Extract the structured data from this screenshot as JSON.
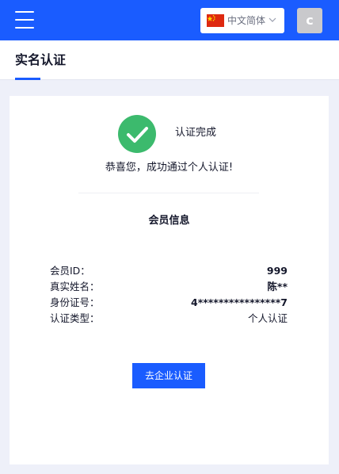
{
  "header": {
    "language": "中文简体",
    "avatar_initial": "c"
  },
  "tabbar": {
    "title": "实名认证"
  },
  "status": {
    "title": "认证完成",
    "message": "恭喜您，成功通过个人认证!"
  },
  "member_info": {
    "title": "会员信息",
    "rows": [
      {
        "label": "会员ID：",
        "value": "999"
      },
      {
        "label": "真实姓名：",
        "value": "陈**"
      },
      {
        "label": "身份证号：",
        "value": "4****************7"
      },
      {
        "label": "认证类型：",
        "value": "个人认证"
      }
    ]
  },
  "actions": {
    "enterprise_label": "去企业认证"
  },
  "colors": {
    "primary": "#1a5cff",
    "success": "#3cba6d"
  }
}
